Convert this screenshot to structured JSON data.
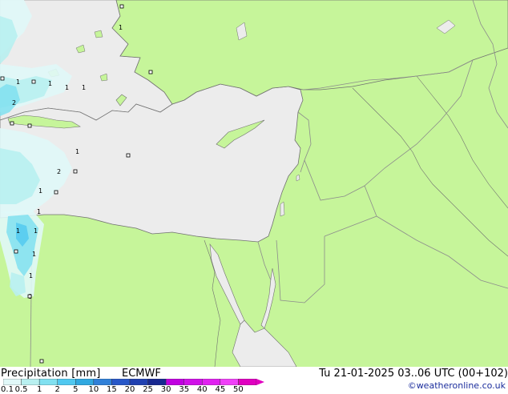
{
  "footer": {
    "title": "Precipitation [mm]",
    "model": "ECMWF",
    "valid_time": "Tu 21-01-2025 03..06 UTC (00+102)",
    "credit": "©weatheronline.co.uk"
  },
  "legend": {
    "ticks": [
      "0.1",
      "0.5",
      "1",
      "2",
      "5",
      "10",
      "15",
      "20",
      "25",
      "30",
      "35",
      "40",
      "45",
      "50"
    ],
    "colors": [
      "#e0f8f8",
      "#b8f0f0",
      "#80e0f0",
      "#50c8f0",
      "#30a8e0",
      "#3080d8",
      "#2858c8",
      "#2040b0",
      "#182890",
      "#c000e0",
      "#d010e8",
      "#e020f0",
      "#f040f8",
      "#e000c0"
    ]
  },
  "map_colors": {
    "land": "#c6f59a",
    "sea": "#ececec",
    "border": "#8c8c8c",
    "coast": "#707070"
  },
  "precip_values": [
    "1",
    "1",
    "1",
    "1",
    "2",
    "1",
    "1",
    "1",
    "2",
    "1",
    "1",
    "1",
    "1",
    "1",
    "0"
  ]
}
